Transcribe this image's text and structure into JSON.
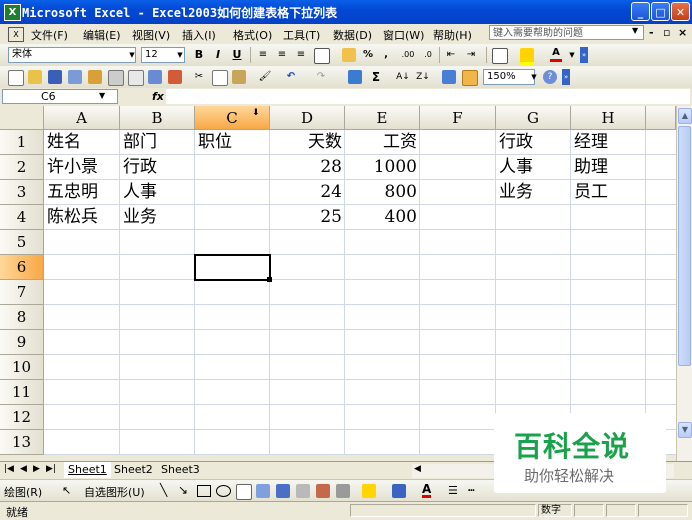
{
  "window": {
    "app_name": "Microsoft Excel",
    "doc_title": "Excel2003如何创建表格下拉列表",
    "title_separator": " - "
  },
  "menu": {
    "items": [
      "文件(F)",
      "编辑(E)",
      "视图(V)",
      "插入(I)",
      "格式(O)",
      "工具(T)",
      "数据(D)",
      "窗口(W)",
      "帮助(H)"
    ],
    "help_placeholder": "键入需要帮助的问题"
  },
  "format_toolbar": {
    "font": "宋体",
    "size": "12",
    "bold": "B",
    "italic": "I",
    "underline": "U",
    "percent": "%",
    "thousands": ",",
    "inc_decimal": ".00",
    "dec_decimal": ".0",
    "font_color_letter": "A"
  },
  "standard_toolbar": {
    "zoom": "150%",
    "sum": "Σ"
  },
  "formula_bar": {
    "name_box": "C6",
    "fx": "fx",
    "content": ""
  },
  "columns": [
    "A",
    "B",
    "C",
    "D",
    "E",
    "F",
    "G",
    "H"
  ],
  "active_column": "C",
  "rows": [
    "1",
    "2",
    "3",
    "4",
    "5",
    "6",
    "7",
    "8",
    "9",
    "10",
    "11",
    "12",
    "13"
  ],
  "active_row": "6",
  "cells": {
    "A1": "姓名",
    "B1": "部门",
    "C1": "职位",
    "D1": "天数",
    "E1": "工资",
    "G1": "行政",
    "H1": "经理",
    "A2": "许小景",
    "B2": "行政",
    "D2": "28",
    "E2": "1000",
    "G2": "人事",
    "H2": "助理",
    "A3": "五忠明",
    "B3": "人事",
    "D3": "24",
    "E3": "800",
    "G3": "业务",
    "H3": "员工",
    "A4": "陈松兵",
    "B4": "业务",
    "D4": "25",
    "E4": "400"
  },
  "selected_cell": "C6",
  "sheet_tabs": [
    "Sheet1",
    "Sheet2",
    "Sheet3"
  ],
  "active_sheet": "Sheet1",
  "drawing_toolbar": {
    "draw_label": "绘图(R)",
    "autoshapes_label": "自选图形(U)"
  },
  "status": {
    "ready": "就绪",
    "num": "数字"
  },
  "watermark": {
    "title": "百科全说",
    "subtitle": "助你轻松解决"
  }
}
